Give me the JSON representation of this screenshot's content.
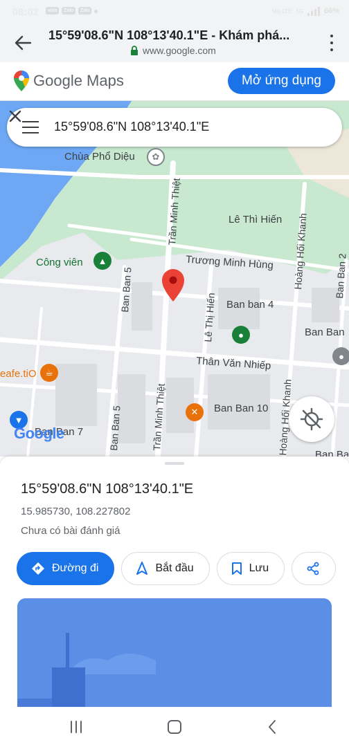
{
  "status_bar": {
    "time": "08:02",
    "apps": [
      "vota",
      "Zalo",
      "Zalo"
    ],
    "network": "Vo) LTE",
    "net_type": "5G",
    "battery": "66%"
  },
  "browser": {
    "title": "15°59'08.6\"N 108°13'40.1\"E - Khám phá...",
    "url": "www.google.com"
  },
  "maps_header": {
    "logo_text": "Google Maps",
    "open_app_label": "Mở ứng dụng"
  },
  "search": {
    "value": "15°59'08.6\"N 108°13'40.1\"E"
  },
  "map": {
    "labels": {
      "chua_pho_dieu": "Chùa Phổ Diệu",
      "le_thi_hien_top": "Lê Thì Hiến",
      "cong_vien": "Công viên",
      "truong_minh_hung": "Trương Minh Hùng",
      "ban_ban_4": "Ban ban 4",
      "ban_ban_right": "Ban Ban",
      "than_van_nhiep": "Thân Văn Nhiếp",
      "cafe_tio": "eafe.tiO",
      "ban_ban_10": "Ban Ban 10",
      "ban_ban_7": "Ban Ban 7",
      "ban_ba_bottom": "Ban Ba",
      "tran_minh_thiet_top": "Trần Minh Thiệt",
      "tran_minh_thiet_bottom": "Trần Minh Thiệt",
      "ban_ban_5_top": "Ban Ban 5",
      "ban_ban_5_bottom": "Ban Ban 5",
      "le_thi_hien_vertical": "Lê Thị Hiến",
      "hoang_hoi_khanh_top": "Hoàng Hối Khanh",
      "hoang_hoi_khanh_bottom": "Hoàng Hối Khanh",
      "ban_ban_2": "Ban Ban 2"
    },
    "watermark": "Google"
  },
  "place": {
    "title": "15°59'08.6\"N 108°13'40.1\"E",
    "coords": "15.985730, 108.227802",
    "review": "Chưa có bài đánh giá"
  },
  "actions": {
    "directions": "Đường đi",
    "start": "Bắt đầu",
    "save": "Lưu"
  },
  "colors": {
    "accent": "#1a73e8",
    "water": "#6ea8f5",
    "park": "#c8e8d0",
    "pin": "#ea4335"
  }
}
